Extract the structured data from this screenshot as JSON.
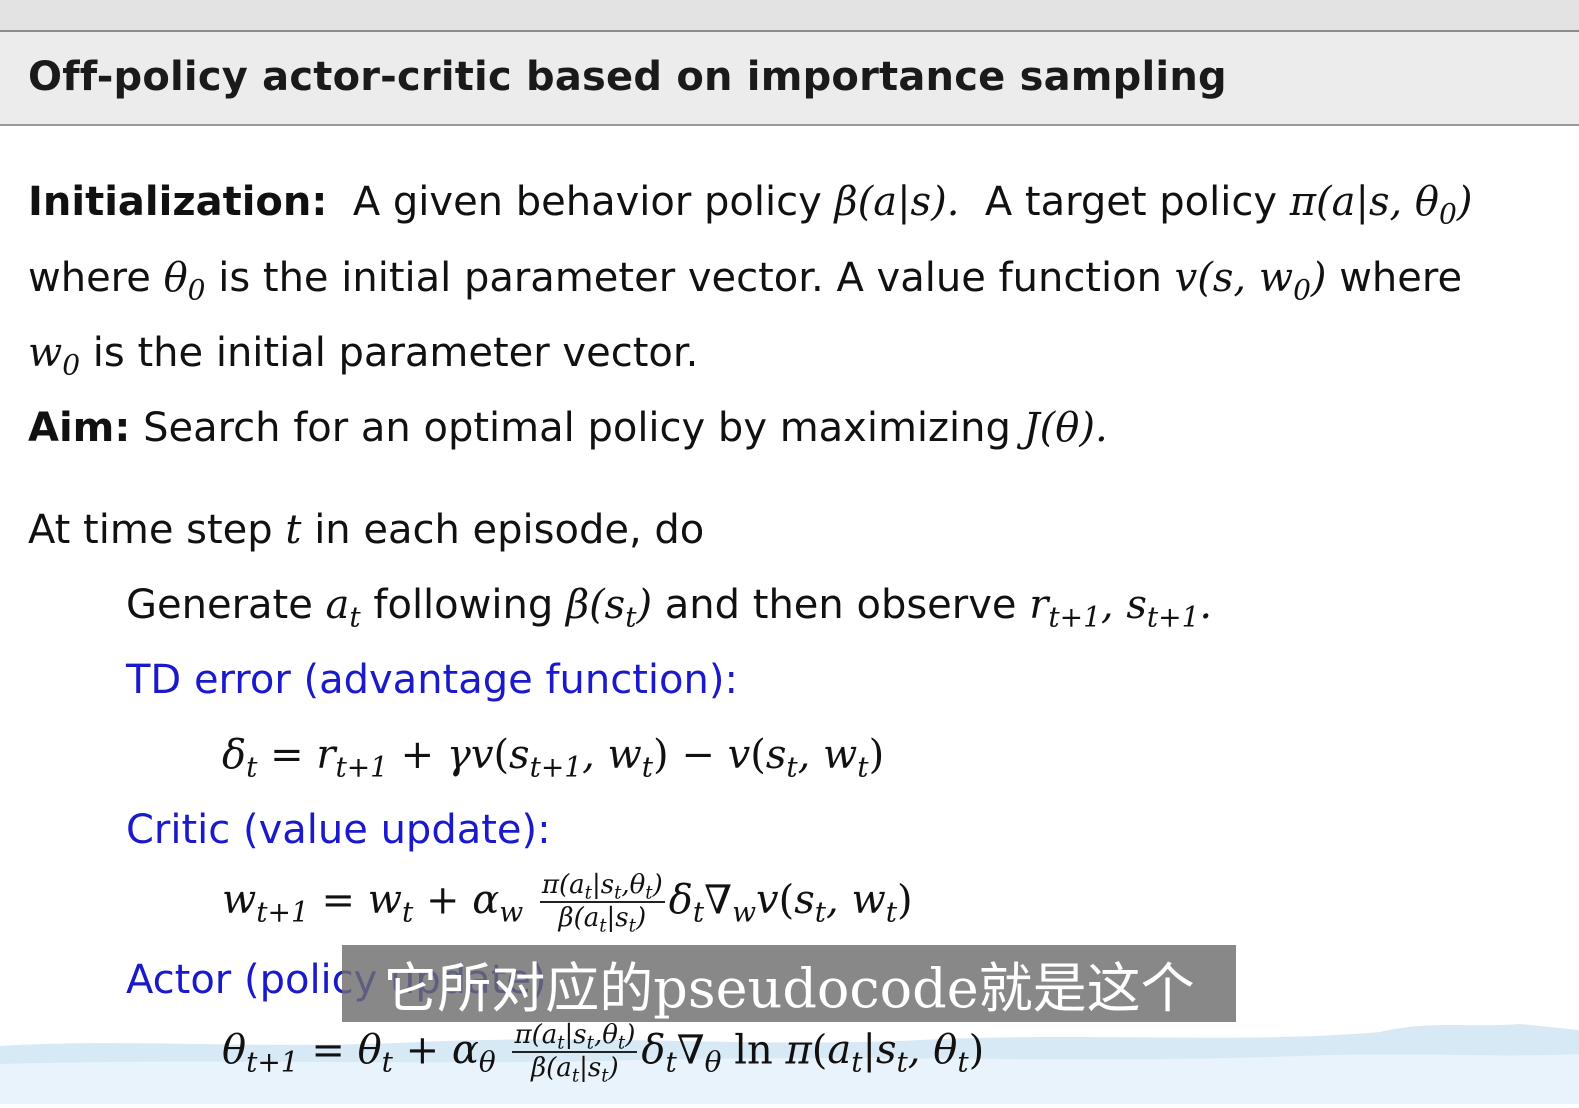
{
  "slide": {
    "title": "Off-policy actor-critic based on importance sampling"
  },
  "init": {
    "label": "Initialization:",
    "t1": "A given behavior policy",
    "beta": "β(a|s).",
    "t2": "A target policy",
    "pi": "π(a|s, θ",
    "pi_sub": "0",
    "pi_end": ")",
    "t3": "where",
    "theta": "θ",
    "theta_sub": "0",
    "t4": "is the initial parameter vector.  A value function",
    "v": "v(s, w",
    "v_sub": "0",
    "v_end": ")",
    "t5": "where",
    "w": "w",
    "w_sub": "0",
    "t6": "is the initial parameter vector."
  },
  "aim": {
    "label": "Aim:",
    "text": "Search for an optimal policy by maximizing",
    "expr": "J(θ)."
  },
  "loop": {
    "header_pre": "At time step",
    "header_var": "t",
    "header_post": "in each episode, do",
    "generate_pre": "Generate",
    "generate_a": "a",
    "generate_a_sub": "t",
    "generate_mid": "following",
    "generate_beta": "β(s",
    "generate_beta_sub": "t",
    "generate_beta_end": ")",
    "generate_post": "and then observe",
    "generate_r": "r",
    "generate_r_sub": "t+1",
    "generate_s": ", s",
    "generate_s_sub": "t+1",
    "generate_dot": "."
  },
  "td": {
    "label": "TD error (advantage function):",
    "eq": "δ_t = r_{t+1} + γv(s_{t+1}, w_t) − v(s_t, w_t)"
  },
  "critic": {
    "label": "Critic (value update):",
    "eq_lhs": "w_{t+1} = w_t + α_w",
    "frac_num": "π(a_t|s_t,θ_t)",
    "frac_den": "β(a_t|s_t)",
    "eq_rhs": "δ_t ∇_w v(s_t, w_t)"
  },
  "actor": {
    "label": "Actor (policy update):",
    "eq_lhs": "θ_{t+1} = θ_t + α_θ",
    "frac_num": "π(a_t|s_t,θ_t)",
    "frac_den": "β(a_t|s_t)",
    "eq_rhs": "δ_t ∇_θ ln π(a_t|s_t, θ_t)"
  },
  "video": {
    "subtitle": "它所对应的pseudocode就是这个"
  },
  "colors": {
    "blue_label": "#1a1acc",
    "title_bg": "#ececec"
  }
}
